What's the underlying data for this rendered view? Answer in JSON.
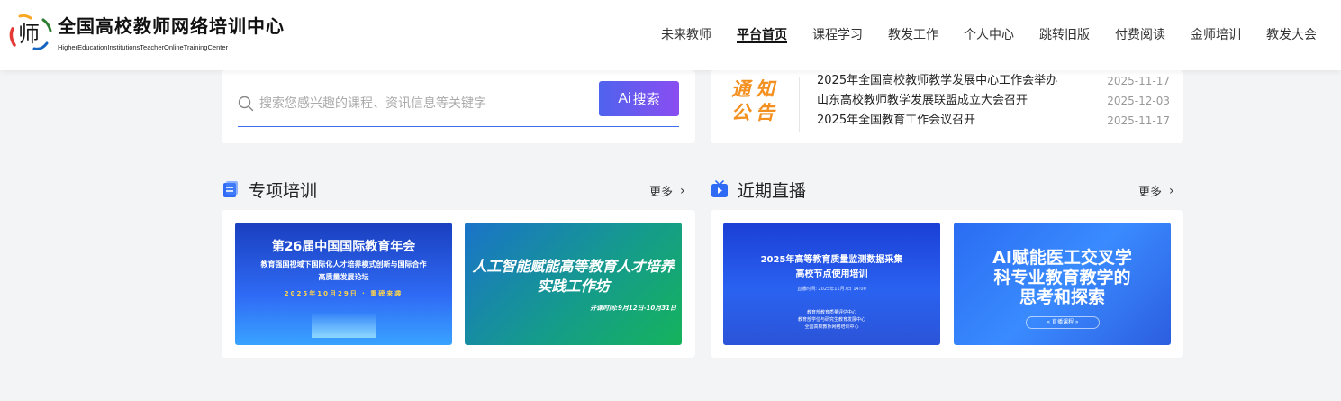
{
  "header": {
    "logo_mark": "师",
    "logo_cn": "全国高校教师网络培训中心",
    "logo_en": "HigherEducationInstitutionsTeacherOnlineTrainingCenter",
    "nav": [
      {
        "label": "未来教师",
        "active": false
      },
      {
        "label": "平台首页",
        "active": true
      },
      {
        "label": "课程学习",
        "active": false
      },
      {
        "label": "教发工作",
        "active": false
      },
      {
        "label": "个人中心",
        "active": false
      },
      {
        "label": "跳转旧版",
        "active": false
      },
      {
        "label": "付费阅读",
        "active": false
      },
      {
        "label": "金师培训",
        "active": false
      },
      {
        "label": "教发大会",
        "active": false
      }
    ]
  },
  "search": {
    "placeholder": "搜索您感兴趣的课程、资讯信息等关键字",
    "button_ai": "Ai",
    "button_label": "搜索",
    "accent": "#4f63ee"
  },
  "notice": {
    "badge_line1": "通知",
    "badge_line2": "公告",
    "badge_color": "#f39020",
    "items": [
      {
        "title": "2025年全国高校教师教学发展中心工作会举办",
        "date": "2025-11-17"
      },
      {
        "title": "山东高校教师教学发展联盟成立大会召开",
        "date": "2025-12-03"
      },
      {
        "title": "2025年全国教育工作会议召开",
        "date": "2025-11-17"
      }
    ]
  },
  "training": {
    "title": "专项培训",
    "more": "更多",
    "cards": [
      {
        "title": "第26届中国国际教育年会",
        "subtitle1": "教育强国视域下国际化人才培养模式创新与国际合作",
        "subtitle2": "高质量发展论坛",
        "date": "2025年10月29日 · 重磅来袭"
      },
      {
        "title_line1": "人工智能赋能高等教育人才培养",
        "title_line2": "实践工作坊",
        "time": "开课时间:9月12日-10月31日"
      }
    ]
  },
  "live": {
    "title": "近期直播",
    "more": "更多",
    "cards": [
      {
        "title_line1": "2025年高等教育质量监测数据采集",
        "title_line2": "高校节点使用培训",
        "meta": "直播时间: 2025年11月7日 14:00",
        "org1": "教育部教育质量评估中心",
        "org2": "教育部学位与研究生教育发展中心",
        "org3": "全国高校教师网络培训中心"
      },
      {
        "title_line1": "AI赋能医工交叉学",
        "title_line2": "科专业教育教学的",
        "title_line3": "思考和探索",
        "pill": "«  直播课程  »"
      }
    ]
  }
}
